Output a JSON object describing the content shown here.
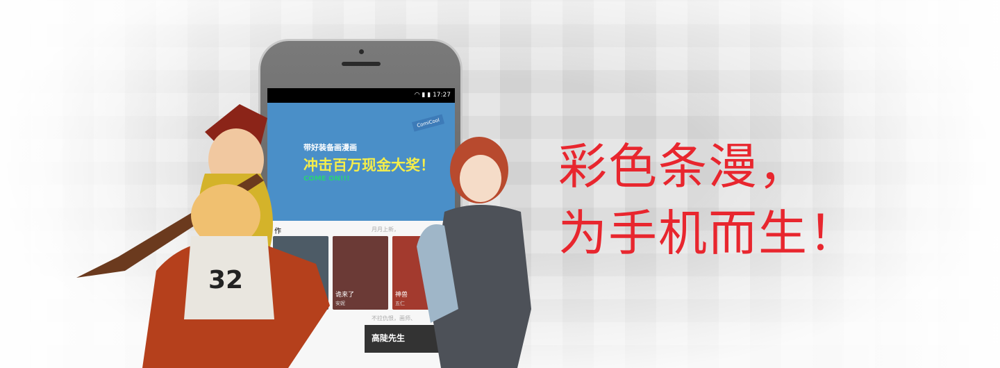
{
  "headline": {
    "line1": "彩色条漫，",
    "line2": "为手机而生！"
  },
  "phone": {
    "status_time": "17:27",
    "banner": {
      "line1": "带好装备画漫画",
      "line2": "冲击百万现金大奖！",
      "line3": "COME ON!!!",
      "tag": "ComiCool"
    },
    "section1": {
      "title": "作",
      "subtitle": "月月上新，"
    },
    "cards": [
      {
        "title": "",
        "author": ""
      },
      {
        "title": "诡来了",
        "author": "安妮"
      },
      {
        "title": "神兽",
        "author": "五仁"
      }
    ],
    "section2": {
      "title": "动",
      "subtitle": "不拉仇恨，画师、"
    },
    "bottom_card": "高陡先生"
  },
  "colors": {
    "accent": "#e8262e",
    "app_blue": "#4a8fc8"
  }
}
